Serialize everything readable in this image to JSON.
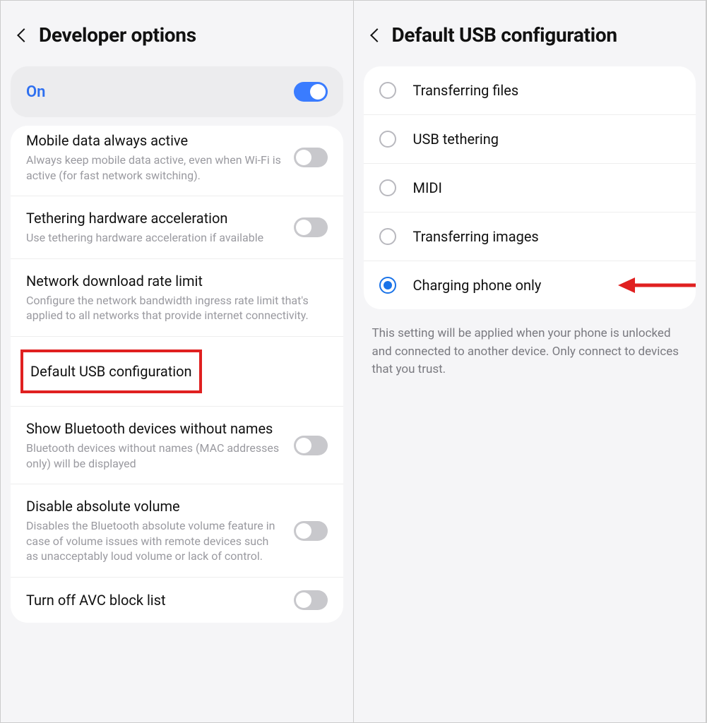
{
  "panel1": {
    "header_title": "Developer options",
    "on_label": "On",
    "on_state": true,
    "items": [
      {
        "title": "Mobile data always active",
        "sub": "Always keep mobile data active, even when Wi-Fi is active (for fast network switching).",
        "toggle": false,
        "cut_top": true
      },
      {
        "title": "Tethering hardware acceleration",
        "sub": "Use tethering hardware acceleration if available",
        "toggle": false
      },
      {
        "title": "Network download rate limit",
        "sub": "Configure the network bandwidth ingress rate limit that's applied to all networks that provide internet connectivity.",
        "toggle": null
      },
      {
        "title": "Default USB configuration",
        "sub": "",
        "toggle": null,
        "highlighted": true
      },
      {
        "title": "Show Bluetooth devices without names",
        "sub": "Bluetooth devices without names (MAC addresses only) will be displayed",
        "toggle": false
      },
      {
        "title": "Disable absolute volume",
        "sub": "Disables the Bluetooth absolute volume feature in case of volume issues with remote devices such as unacceptably loud volume or lack of control.",
        "toggle": false
      },
      {
        "title": "Turn off AVC block list",
        "sub": "",
        "toggle": false
      }
    ]
  },
  "panel2": {
    "header_title": "Default USB configuration",
    "options": [
      {
        "label": "Transferring files",
        "selected": false
      },
      {
        "label": "USB tethering",
        "selected": false
      },
      {
        "label": "MIDI",
        "selected": false
      },
      {
        "label": "Transferring images",
        "selected": false
      },
      {
        "label": "Charging phone only",
        "selected": true,
        "arrow": true
      }
    ],
    "footnote": "This setting will be applied when your phone is unlocked and connected to another device. Only connect to devices that you trust."
  }
}
